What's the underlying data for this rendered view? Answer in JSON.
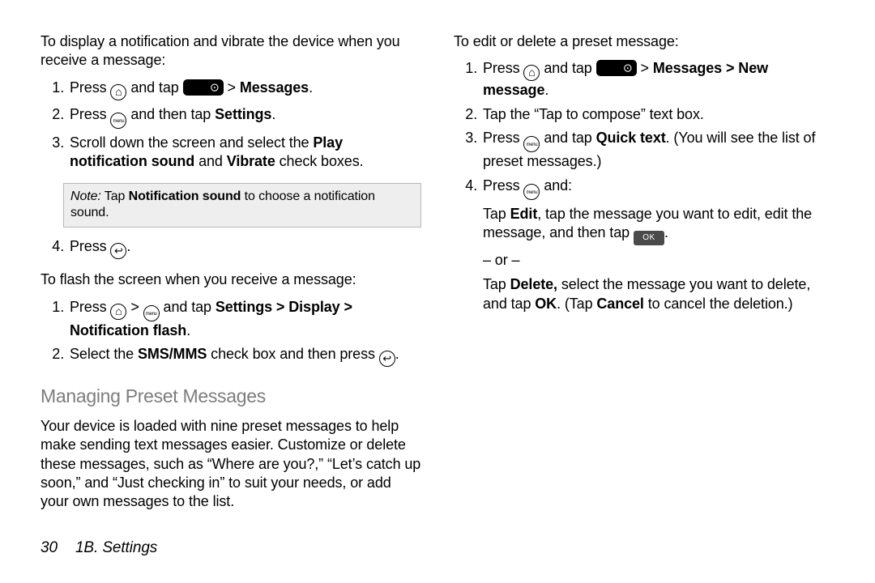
{
  "left": {
    "intro1": "To display a notification and vibrate the device when you receive a message:",
    "l1a": "Press ",
    "l1b": " and tap ",
    "l1c": "Messages",
    "l1d": ".",
    "l2a": "Press ",
    "l2b": " and then tap ",
    "l2c": "Settings",
    "l2d": ".",
    "l3a": "Scroll down the screen and select the ",
    "l3b": "Play notification sound",
    "l3c": " and ",
    "l3d": "Vibrate",
    "l3e": " check boxes.",
    "noteLbl": "Note:",
    "noteA": " Tap ",
    "noteB": "Notification sound",
    "noteC": " to choose a notification sound.",
    "l4a": "Press ",
    "l4b": ".",
    "intro2": "To flash the screen when you receive a message:",
    "f1a": "Press ",
    "f1b": " and tap ",
    "f1c": "Settings > Display > Notification flash",
    "f1d": ".",
    "f2a": "Select the ",
    "f2b": "SMS/MMS",
    "f2c": " check box and then press ",
    "f2d": ".",
    "heading": "Managing Preset Messages",
    "para": "Your device is loaded with nine preset messages to help make sending text messages easier. Customize or delete these messages, such as “Where are you?,” “Let’s catch up soon,” and “Just checking in” to suit your needs, or add your own messages to the list."
  },
  "right": {
    "intro": "To edit or delete a preset message:",
    "r1a": "Press ",
    "r1b": " and tap ",
    "r1c": "Messages > New message",
    "r1d": ".",
    "r2": "Tap the “Tap to compose” text box.",
    "r3a": "Press ",
    "r3b": " and tap ",
    "r3c": "Quick text",
    "r3d": ". (You will see the list of preset messages.)",
    "r4a": "Press ",
    "r4b": " and:",
    "pA1": "Tap ",
    "pA2": "Edit",
    "pA3": ", tap the message you want to edit, edit the message, and then tap ",
    "pA4": ".",
    "or": "– or –",
    "pB1": "Tap ",
    "pB2": "Delete,",
    "pB3": " select the message you want to delete, and tap ",
    "pB4": "OK",
    "pB5": ". (Tap ",
    "pB6": "Cancel",
    "pB7": " to cancel the deletion.)"
  },
  "okLabel": "OK",
  "footer": {
    "page": "30",
    "section": "1B. Settings"
  }
}
